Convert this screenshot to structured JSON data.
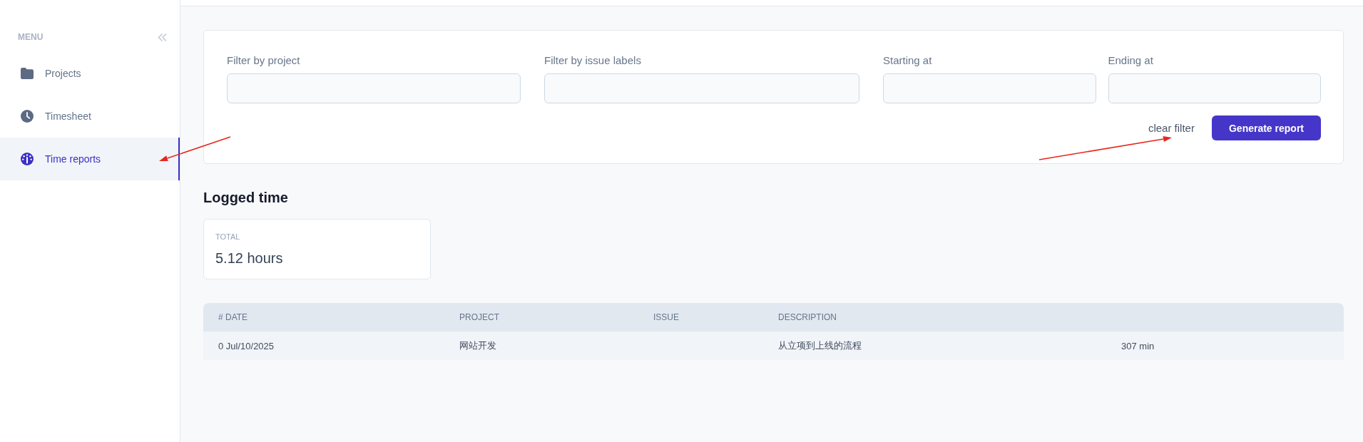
{
  "sidebar": {
    "heading": "MENU",
    "items": [
      {
        "label": "Projects",
        "selected": false
      },
      {
        "label": "Timesheet",
        "selected": false
      },
      {
        "label": "Time reports",
        "selected": true
      }
    ]
  },
  "filters": {
    "fields": [
      {
        "label": "Filter by project"
      },
      {
        "label": "Filter by issue labels"
      },
      {
        "label": "Starting at"
      },
      {
        "label": "Ending at"
      }
    ],
    "clear_link": "clear filter",
    "generate_button": "Generate report"
  },
  "logged_time": {
    "title": "Logged time",
    "total": {
      "label": "TOTAL",
      "value": "5.12 hours"
    }
  },
  "table": {
    "columns": [
      "# DATE",
      "PROJECT",
      "ISSUE",
      "DESCRIPTION"
    ],
    "rows": [
      {
        "date": "0 Jul/10/2025",
        "project": "网站开发",
        "description": "从立项到上线的流程",
        "column_5": "307 min"
      }
    ]
  }
}
